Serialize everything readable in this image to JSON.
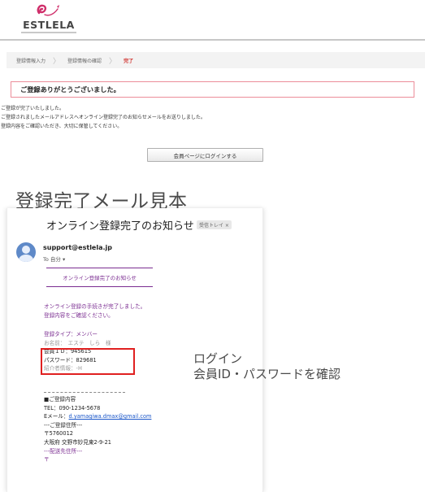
{
  "site": {
    "logo_text": "ESTLELA"
  },
  "breadcrumb": {
    "steps": [
      "登録情報入力",
      "登録情報の確認",
      "完了"
    ]
  },
  "complete": {
    "heading": "ご登録ありがとうございました。",
    "lines": [
      "ご登録が完了いたしました。",
      "ご登録されましたメールアドレスへオンライン登録完了のお知らせメールをお送りしました。",
      "登録内容をご確認いただき、大切に保管してください。"
    ],
    "login_button": "会員ページにログインする"
  },
  "sample": {
    "title": "登録完了メール見本"
  },
  "email": {
    "subject": "オンライン登録完了のお知らせ",
    "inbox_tag": "受信トレイ ×",
    "sender": "support@estlela.jp",
    "to": "To 自分 ▾",
    "notice_title": "オンライン登録完了のお知らせ",
    "body_lines": [
      "オンライン登録の手続きが完了しました。",
      "登録内容をご確認ください。"
    ],
    "info": {
      "type": "登録タイプ：メンバー",
      "name": "お名前：　エステ　しら　様",
      "member_id": "会員ＩＤ：945615",
      "password": "パスワード：829681",
      "referral": "紹介者情報：-",
      "referral_tail": "H"
    },
    "registration": {
      "heading": "■ご登録内容",
      "tel": "TEL：090-1234-5678",
      "email_label": "Eメール：",
      "email_value": "d.yamagiwa.dmax@gmail.com",
      "address_heading": "---ご登録住所---",
      "zip": "〒5760012",
      "address": "大阪府 交野市妙見東2-9-21",
      "delivery_heading": "---配送先住所---",
      "delivery_zip": "〒"
    }
  },
  "annotation": {
    "line1": "ログイン",
    "line2": "会員ID・パスワードを確認"
  },
  "colors": {
    "accent_purple": "#7b2d91",
    "highlight_red": "#e02020",
    "breadcrumb_active": "#d0312d",
    "thanks_border": "#ec8d9a"
  }
}
